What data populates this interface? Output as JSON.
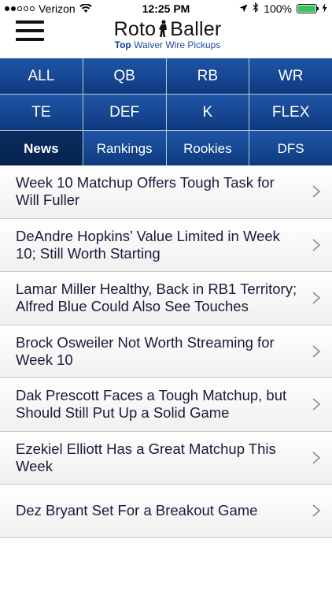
{
  "status_bar": {
    "carrier": "Verizon",
    "time": "12:25 PM",
    "battery": "100%",
    "battery_level": 1.0,
    "signal_bars_filled": 2,
    "signal_bars_total": 5
  },
  "header": {
    "logo_text_left": "Roto",
    "logo_text_right": "Baller",
    "tagline_bold": "Top",
    "tagline_rest": " Waiver Wire Pickups"
  },
  "positions": [
    "ALL",
    "QB",
    "RB",
    "WR",
    "TE",
    "DEF",
    "K",
    "FLEX"
  ],
  "tabs": [
    {
      "label": "News",
      "active": true
    },
    {
      "label": "Rankings",
      "active": false
    },
    {
      "label": "Rookies",
      "active": false
    },
    {
      "label": "DFS",
      "active": false
    }
  ],
  "news": [
    {
      "line1": "Week 10 Matchup Offers Tough Task for",
      "line2": "Will Fuller"
    },
    {
      "line1": "DeAndre Hopkins’ Value Limited in Week",
      "line2": "10; Still Worth Starting"
    },
    {
      "line1": "Lamar Miller Healthy, Back in RB1 Territory;",
      "line2": "Alfred Blue Could Also See Touches"
    },
    {
      "line1": "Brock Osweiler Not Worth Streaming for",
      "line2": "Week 10"
    },
    {
      "line1": "Dak Prescott Faces a Tough Matchup, but",
      "line2": "Should Still Put Up a Solid Game"
    },
    {
      "line1": "Ezekiel Elliott Has a Great Matchup This",
      "line2": "Week"
    },
    {
      "line1": "Dez Bryant Set For a Breakout Game",
      "line2": ""
    }
  ],
  "colors": {
    "nav_blue": "#1f55a6",
    "nav_active": "#0a2c60",
    "battery_green": "#34c759"
  }
}
